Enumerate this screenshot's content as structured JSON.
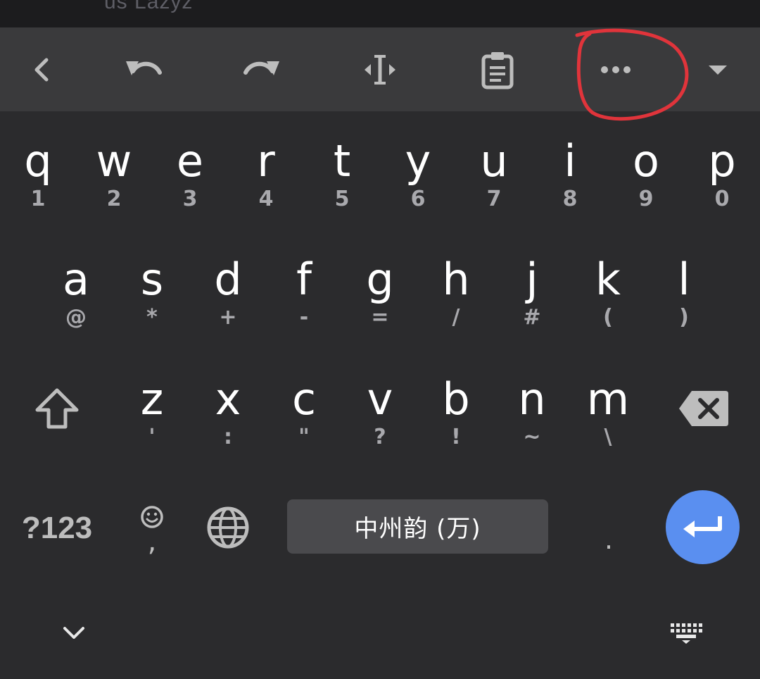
{
  "top_strip": {
    "text": "us Lazyz"
  },
  "toolbar": {
    "buttons": [
      {
        "name": "back",
        "icon": "chevron-left-icon"
      },
      {
        "name": "undo",
        "icon": "undo-icon"
      },
      {
        "name": "redo",
        "icon": "redo-icon"
      },
      {
        "name": "cursor",
        "icon": "text-cursor-icon"
      },
      {
        "name": "clipboard",
        "icon": "clipboard-icon"
      },
      {
        "name": "more",
        "icon": "more-dots-icon"
      },
      {
        "name": "collapse",
        "icon": "caret-down-icon"
      }
    ],
    "annotation_color": "#e0343b"
  },
  "keyboard": {
    "row1": [
      {
        "main": "q",
        "hint": "1"
      },
      {
        "main": "w",
        "hint": "2"
      },
      {
        "main": "e",
        "hint": "3"
      },
      {
        "main": "r",
        "hint": "4"
      },
      {
        "main": "t",
        "hint": "5"
      },
      {
        "main": "y",
        "hint": "6"
      },
      {
        "main": "u",
        "hint": "7"
      },
      {
        "main": "i",
        "hint": "8"
      },
      {
        "main": "o",
        "hint": "9"
      },
      {
        "main": "p",
        "hint": "0"
      }
    ],
    "row2": [
      {
        "main": "a",
        "hint": "@"
      },
      {
        "main": "s",
        "hint": "*"
      },
      {
        "main": "d",
        "hint": "+"
      },
      {
        "main": "f",
        "hint": "-"
      },
      {
        "main": "g",
        "hint": "="
      },
      {
        "main": "h",
        "hint": "/"
      },
      {
        "main": "j",
        "hint": "#"
      },
      {
        "main": "k",
        "hint": "("
      },
      {
        "main": "l",
        "hint": ")"
      }
    ],
    "row3": [
      {
        "main": "z",
        "hint": "'"
      },
      {
        "main": "x",
        "hint": ":"
      },
      {
        "main": "c",
        "hint": "\""
      },
      {
        "main": "v",
        "hint": "?"
      },
      {
        "main": "b",
        "hint": "!"
      },
      {
        "main": "n",
        "hint": "~"
      },
      {
        "main": "m",
        "hint": "\\"
      }
    ],
    "symbols_label": "?123",
    "emoji_comma": ",",
    "space_label": "中州韵 (万)",
    "period": ".",
    "enter_color": "#5a8ff0"
  },
  "nav": {
    "hide_icon": "chevron-down-icon",
    "switch_icon": "keyboard-icon"
  }
}
